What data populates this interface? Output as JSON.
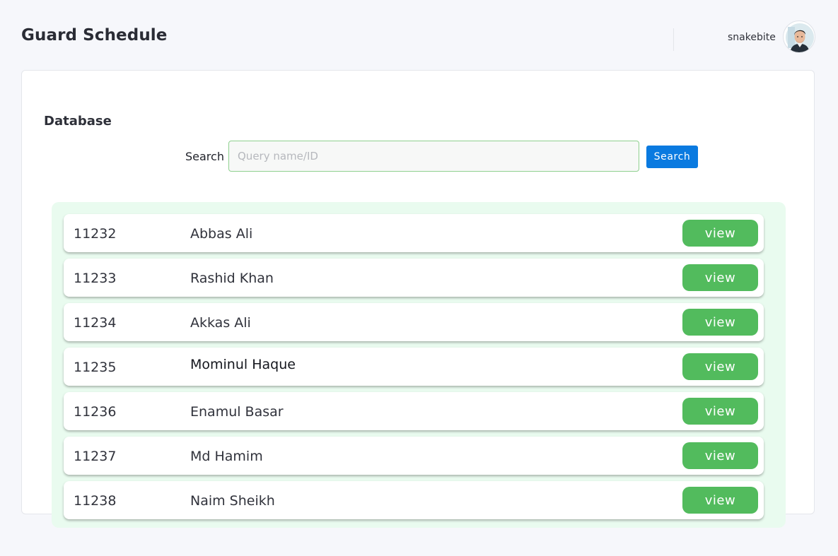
{
  "header": {
    "title": "Guard Schedule",
    "username": "snakebite",
    "avatar_icon": "user-avatar"
  },
  "database": {
    "title": "Database",
    "search_label": "Search",
    "search_placeholder": "Query name/ID",
    "search_value": "",
    "search_button": "Search"
  },
  "rows": [
    {
      "id": "11232",
      "name": "Abbas Ali",
      "action": "view"
    },
    {
      "id": "11233",
      "name": "Rashid Khan",
      "action": "view"
    },
    {
      "id": "11234",
      "name": "Akkas Ali",
      "action": "view"
    },
    {
      "id": "11235",
      "name": "Mominul Haque",
      "action": "view"
    },
    {
      "id": "11236",
      "name": "Enamul Basar",
      "action": "view"
    },
    {
      "id": "11237",
      "name": "Md Hamim",
      "action": "view"
    },
    {
      "id": "11238",
      "name": "Naim Sheikh",
      "action": "view"
    }
  ],
  "colors": {
    "accent_green": "#52bb5d",
    "search_blue": "#0a7ae0",
    "list_background": "#e9fbef",
    "input_border": "#8fd08f"
  }
}
